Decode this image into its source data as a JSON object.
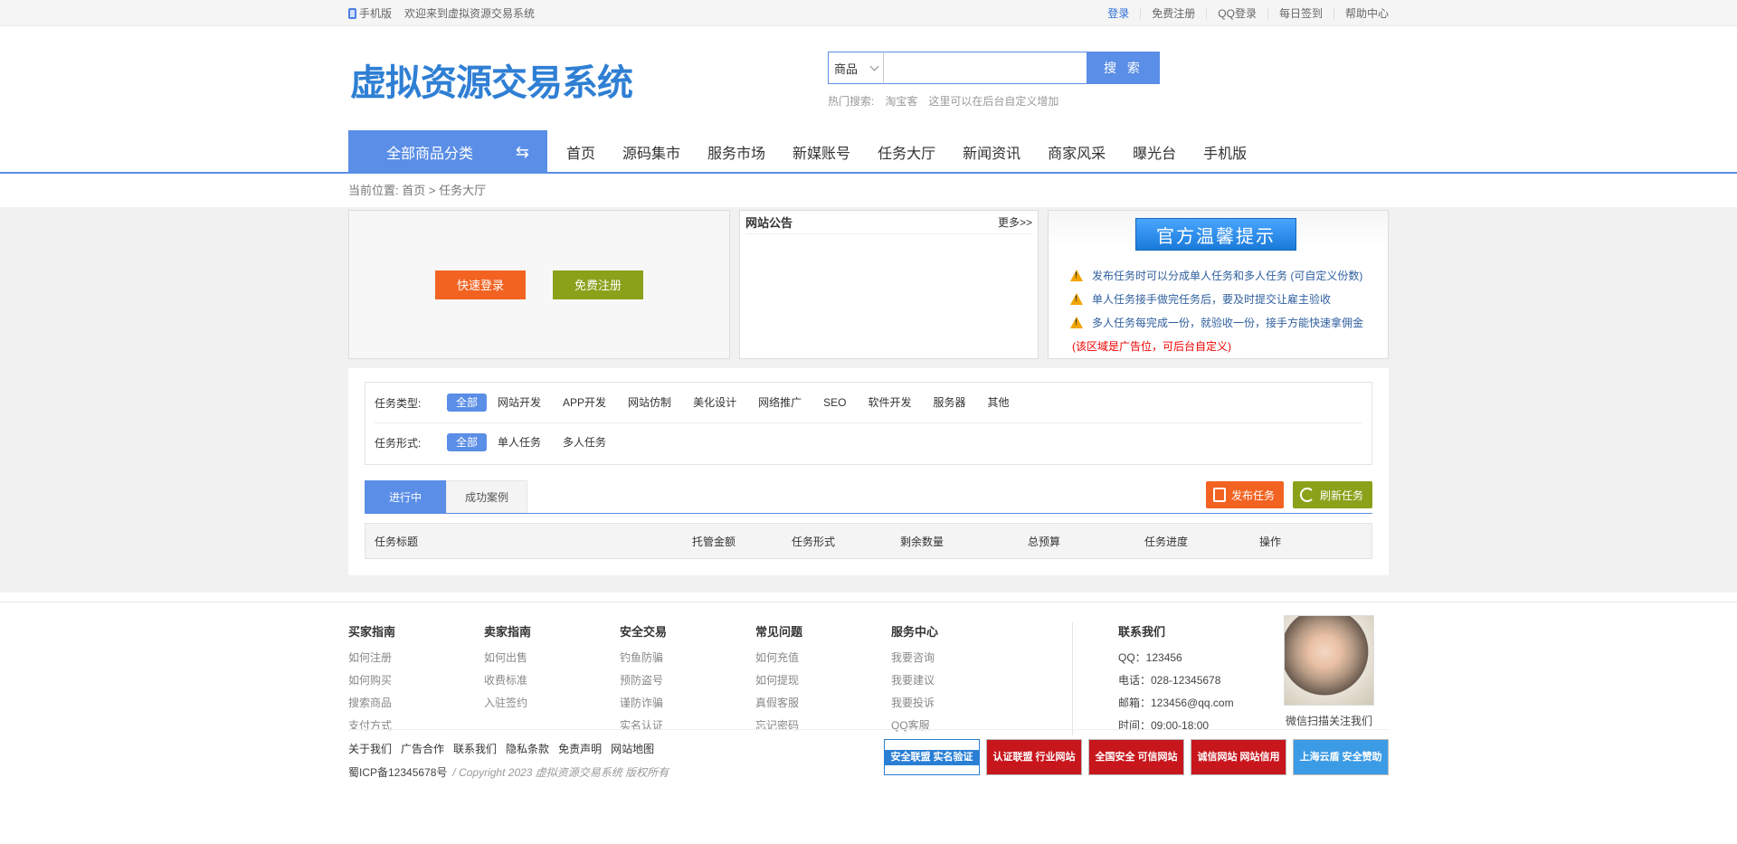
{
  "topbar": {
    "mobile_label": "手机版",
    "welcome": "欢迎来到虚拟资源交易系统",
    "links": [
      "登录",
      "免费注册",
      "QQ登录",
      "每日签到",
      "帮助中心"
    ]
  },
  "header": {
    "logo_text": "虚拟资源交易系统",
    "search": {
      "category": "商品",
      "placeholder": "",
      "button": "搜 索"
    },
    "hot": {
      "label": "热门搜索:",
      "items": [
        "淘宝客",
        "这里可以在后台自定义增加"
      ]
    }
  },
  "nav": {
    "all_categories": "全部商品分类",
    "items": [
      "首页",
      "源码集市",
      "服务市场",
      "新媒账号",
      "任务大厅",
      "新闻资讯",
      "商家风采",
      "曝光台",
      "手机版"
    ]
  },
  "breadcrumb": {
    "label": "当前位置:",
    "home": "首页",
    "sep": ">",
    "current": "任务大厅"
  },
  "login_box": {
    "quick_login": "快速登录",
    "register": "免费注册"
  },
  "notice": {
    "title": "网站公告",
    "more": "更多>>"
  },
  "tips": {
    "title": "官方温馨提示",
    "items": [
      "发布任务时可以分成单人任务和多人任务 (可自定义份数)",
      "单人任务接手做完任务后，要及时提交让雇主验收",
      "多人任务每完成一份，就验收一份，接手方能快速拿佣金"
    ],
    "ad_note": "(该区域是广告位，可后台自定义)"
  },
  "filters": {
    "type_label": "任务类型:",
    "types": [
      "全部",
      "网站开发",
      "APP开发",
      "网站仿制",
      "美化设计",
      "网络推广",
      "SEO",
      "软件开发",
      "服务器",
      "其他"
    ],
    "form_label": "任务形式:",
    "forms": [
      "全部",
      "单人任务",
      "多人任务"
    ]
  },
  "tabs": [
    "进行中",
    "成功案例"
  ],
  "actions": {
    "publish": "发布任务",
    "refresh": "刷新任务"
  },
  "table": {
    "headers": [
      "任务标题",
      "托管金额",
      "任务形式",
      "剩余数量",
      "总预算",
      "任务进度",
      "操作"
    ]
  },
  "footer": {
    "columns": [
      {
        "title": "买家指南",
        "links": [
          "如何注册",
          "如何购买",
          "搜索商品",
          "支付方式"
        ]
      },
      {
        "title": "卖家指南",
        "links": [
          "如何出售",
          "收费标准",
          "入驻签约"
        ]
      },
      {
        "title": "安全交易",
        "links": [
          "钓鱼防骗",
          "预防盗号",
          "谨防诈骗",
          "实名认证"
        ]
      },
      {
        "title": "常见问题",
        "links": [
          "如何充值",
          "如何提现",
          "真假客服",
          "忘记密码"
        ]
      },
      {
        "title": "服务中心",
        "links": [
          "我要咨询",
          "我要建议",
          "我要投诉",
          "QQ客服"
        ]
      }
    ],
    "contact": {
      "title": "联系我们",
      "qq": "QQ：123456",
      "phone": "电话：028-12345678",
      "email": "邮箱：123456@qq.com",
      "hours": "时间：09:00-18:00"
    },
    "qr_caption": "微信扫描关注我们",
    "links": [
      "关于我们",
      "广告合作",
      "联系我们",
      "隐私条款",
      "免责声明",
      "网站地图"
    ],
    "icp": "蜀ICP备12345678号",
    "copyright": "/ Copyright 2023 虚拟资源交易系统 版权所有",
    "badges": [
      "安全联盟 实名验证",
      "认证联盟 行业网站",
      "全国安全 可信网站",
      "诚信网站 网站信用",
      "上海云盾 安全赞助"
    ]
  }
}
